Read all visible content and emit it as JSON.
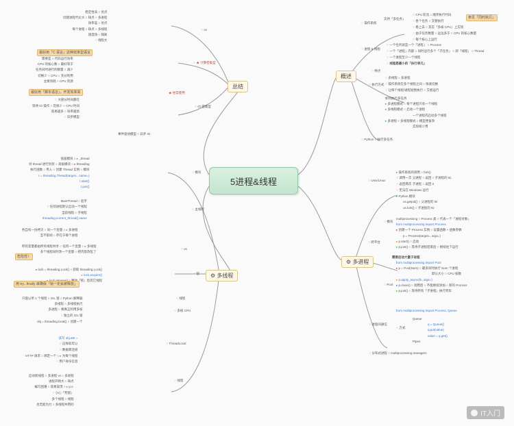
{
  "center": "5进程&线程",
  "branches": {
    "overview": {
      "label": "概述"
    },
    "multiproc": {
      "label": "多进程"
    },
    "multithread": {
      "label": "多线程"
    },
    "summary": {
      "label": "总结"
    }
  },
  "overview": {
    "os": {
      "label": "操作系统",
      "multitask": "支持「多任务」",
      "cpu_turn": "CPU 轮流",
      "seq_exec": "顺序执行代码",
      "each_task": "各个任务",
      "swap_exec": "交替执行",
      "appears": "看上去",
      "real_multicore": "其实「多核 CPU」上实现",
      "more_than": "由于任务数量",
      "more_cores": "远远多于",
      "core_count": "CPU 的核心数量",
      "so_each": "每个核心上运行",
      "hl": "参见「同时执行」"
    },
    "proc_thread": {
      "label": "进程 & 线程",
      "one_task": "一个任务就是一个「进程」",
      "proc": "Process",
      "a_proc": "一个「进程」内部",
      "run_sub": "同时运行多个「子任务」",
      "named_thread": "即「线程」",
      "thread": "Thread",
      "at_least": "一个进程至少一个线程",
      "min_unit": "线程是最小的「执行单元」",
      "feat": "特点",
      "mp_eq_mt": "多线程 = 多进程",
      "os_alt": "操作系统在多个线程之间",
      "fast_sw": "快速切换",
      "exec": "执行方式",
      "so_each2": "让每个线程/进程短暂执行",
      "alt_run": "交替运行",
      "multi_task_impl": "如何执行多任务",
      "mp": "多进程模式",
      "mp_each": "每个进程只有一个线程",
      "mt": "多线程模式",
      "mt_one": "启动一个进程",
      "mt_many": "一个进程内启动多个线程",
      "mix": "多进程 + 多线程模式",
      "mix_l": "模型更复杂",
      "mix_r": "实际很少用"
    },
    "python": {
      "label": "Python",
      "exec": "执行多任务"
    }
  },
  "multiproc": {
    "icon": "⚙",
    "unix": {
      "label": "Unix/Linux",
      "os_call": "操作系统的调用",
      "fork": "fork()",
      "once": "调用一次",
      "ret_twice": "返回两次",
      "parent": "父进程",
      "child": "子进程",
      "ret_cid": "返回",
      "cid": "子进程的 ID",
      "ret0": "返回 0",
      "py_mod": "Python 模块",
      "getpid": "os.getpid()",
      "getpid_l": "父进程的 ID",
      "osfork": "os.fork()",
      "osfork_l": "子进程的 ID",
      "no_win": "无法在 Windows 运行"
    },
    "cross": {
      "label": "跨平台",
      "mp_cls": "multiprocessing",
      "proc_cls": "Process 类",
      "proc_obj": "代表一个「进程对象」",
      "mod": "模块",
      "import": "from multiprocessing import Process",
      "create": "创建一个 Process 实例",
      "args": "设置函数 + 函数参数",
      "p_eq": "p = Process(target=, args=)",
      "start": "p.start()",
      "start_l": "启动",
      "join": "p.join()",
      "join_l": "等待子进程结束后",
      "join_r": "继续往下运行",
      "need_many": "需要启动大量子进程",
      "pool": "Pool",
      "pool_import": "from multiprocessing import Pool",
      "pool_ctor": "p = Pool(Num)",
      "pool_arg": "最多同时执行 Num 个进程",
      "pool_def": "默认大小",
      "pool_def_r": "CPU 核数",
      "apply": "p.apply_async(fn, args=)",
      "close": "p.close()",
      "close_l": "调用后",
      "close_r": "不能继续添加",
      "close_n": "新的 Process",
      "pjoin": "p.join()",
      "pjoin_l": "等待所有「子进程」执行完毕"
    },
    "comm": {
      "label": "进程间通信",
      "import": "from multiprocessing import Process, Queue",
      "method": "方式",
      "queue": "Queue",
      "q0": "q = Queue()",
      "q1": "q.put(value)",
      "q2": "value = q.get()",
      "pipes": "Pipes"
    },
    "dist": {
      "label": "分布式进程",
      "mgr": "multiprocessing.managers"
    }
  },
  "multithread": {
    "icon": "⚙",
    "modules": {
      "label": "模块",
      "low": "低级模块",
      "p_thread": "_thread",
      "high": "高级模块",
      "p_threading": "threading",
      "can": "对 thread 进行封装",
      "fn": "执行函数",
      "pass": "传入",
      "create": "创建 Thread 实例",
      "code": "t = threading.Thread(target=, name=)",
      "tstart": "t.start()",
      "tjoin": "t.join()",
      "main": "主线程",
      "main_name": "MainThread",
      "name_l": "名字",
      "any_start": "任何进程默认启动一个线程",
      "cur": "当前线程",
      "sub": "子线程",
      "cur_name": "threading.current_thread().name"
    },
    "lock": {
      "label": "锁",
      "mp_box": "多进程",
      "each_copy": "各自有一份拷贝",
      "same_var": "同一个变量",
      "no_affect": "互不影响",
      "in_proc": "存在于每个进程",
      "vs": "vs",
      "mt_box": "多线程",
      "share": "所有变量都由所有线程共享",
      "one_var": "任何一个变量",
      "alert": "危险性！",
      "many_mod": "多个线程同时改一个变量",
      "confuse": "把内容改乱了",
      "gain": "获取 threading.Lock()",
      "lock_code": "lock = threading.Lock()",
      "acquire": "lock.acquire()",
      "try_fin": "用 try...finally 来确保「锁一定会被释放」",
      "release": "释放「锁」后其它线程",
      "rel_code": "lock.release()",
      "thread": "线程",
      "only_one": "只能以单 1 个线程",
      "gil": "GIL 锁",
      "py_int": "Python 解释器",
      "cpu": "多核 CPU",
      "mt_l": "多线程",
      "mt_r": "多线程执行",
      "cant_multi": "要真正利用多核",
      "mp_r": "多进程",
      "own_gil": "独立的 GIL 锁",
      "ob": "obj = threading.local()",
      "ob_l": "创建一个",
      "tl": "ThreadLocal",
      "attr": "读写 obj.attr =",
      "easy": "这样就可以",
      "db": "数据库连接",
      "http": "HTTP 请求",
      "bind": "绑定一个",
      "why": "为每个线程",
      "user": "用户身份信息"
    },
    "other": {
      "label": "线程",
      "proc_mt_l": "启动新线程",
      "proc_mt_r": "多进程 vs",
      "proc_mt": "多进程",
      "cons": "缺点",
      "expensive": "进程开销大",
      "hard": "编写困难",
      "crash": "容易崩溃",
      "care": "小心「死锁」",
      "ps": "p.s.",
      "sub_l": "多个线程",
      "sub": "线程",
      "kill": "也无能为力",
      "rand": "多线程共用的"
    }
  },
  "summary": {
    "pm": {
      "label": "vs",
      "cons": "缺点",
      "pros": "优点",
      "stable": "稳定性高",
      "mem_big": "创建进程代价大",
      "low_eff": "效率差",
      "isol": "每个进程",
      "isol_r": "隔离",
      "mp_label": "多进程",
      "mt_label": "多线程",
      "fast": "速度快",
      "mem_share": "线程大"
    },
    "calc": {
      "label": "计算密集型",
      "hl": "最好用「C 语言」这种效率型语言",
      "need": "需要是",
      "code_eff": "代码运行效率",
      "cpu_core": "CPU 的核心数",
      "best_eq": "最好等于",
      "during": "任务同时进行的数量",
      "few": "减少",
      "switch": "切换少",
      "cpu": "CPU",
      "use_cpu": "充分利用",
      "main": "主要消耗",
      "cpu_res": "CPU 资源"
    },
    "io": {
      "label": "IO 密集型",
      "star": "★ 经常使用",
      "lang": "最好用「脚本语言」，开发效率高",
      "most_time": "大部分时间都在",
      "wait": "等待 IO 操作",
      "less_cpu": "花很少",
      "cpu_t": "CPU 时间",
      "more": "容易越多",
      "eff_high": "效率越高",
      "async": "异步模型"
    },
    "async2": {
      "label": "异步 IO",
      "model": "事件驱动模型"
    }
  },
  "watermark": {
    "text": "IT入门"
  }
}
